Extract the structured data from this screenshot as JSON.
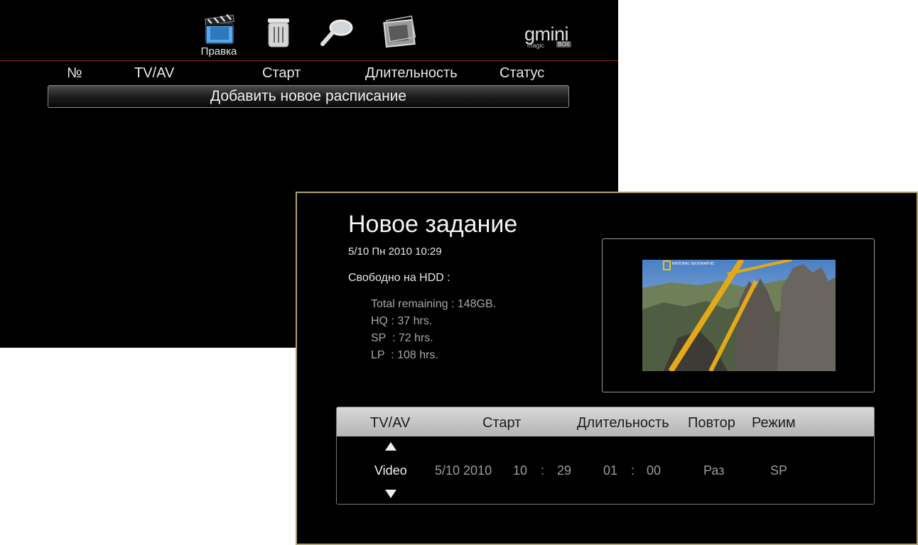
{
  "back_screen": {
    "toolbar": {
      "edit_label": "Правка",
      "icons": [
        "clapperboard-icon",
        "trash-icon",
        "search-icon",
        "film-strip-icon"
      ]
    },
    "logo": {
      "brand": "gmini",
      "sub": "magic",
      "box": "BOX"
    },
    "columns": {
      "number": "№",
      "tv_av": "TV/AV",
      "start": "Старт",
      "duration": "Длительность",
      "status": "Статус"
    },
    "add_button_label": "Добавить новое расписание",
    "divider_color": "#8c1f1f"
  },
  "front_screen": {
    "title": "Новое задание",
    "datetime": "5/10 Пн 2010 10:29",
    "hdd_label": "Свободно на HDD :",
    "hdd": {
      "total": "Total remaining : 148GB.",
      "hq": "HQ : 37 hrs.",
      "sp": "SP  : 72 hrs.",
      "lp": "LP  : 108 hrs."
    },
    "preview_watermark": "NATIONAL GEOGRAPHIC",
    "frame_color": "#b2a373",
    "table": {
      "headers": {
        "tv_av": "TV/AV",
        "start": "Старт",
        "duration": "Длительность",
        "repeat": "Повтор",
        "mode": "Режим"
      },
      "row": {
        "source": "Video",
        "date": "5/10 2010",
        "start_hour": "10",
        "start_sep": ":",
        "start_min": "29",
        "dur_hour": "01",
        "dur_sep": ":",
        "dur_min": "00",
        "repeat": "Раз",
        "mode": "SP"
      }
    }
  }
}
